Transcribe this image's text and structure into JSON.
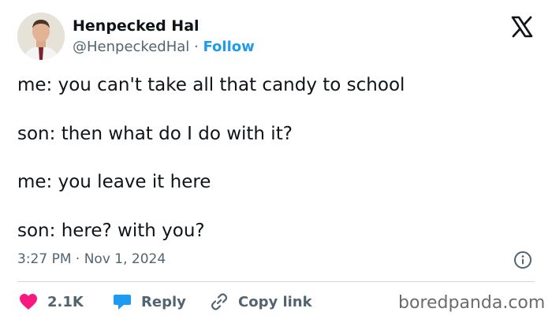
{
  "author": {
    "name": "Henpecked Hal",
    "handle": "@HenpeckedHal",
    "separator": "·",
    "follow_label": "Follow"
  },
  "tweet": {
    "lines": [
      "me: you can't take all that candy to school",
      "son: then what do I do with it?",
      "me: you leave it here",
      "son: here? with you?"
    ],
    "time": "3:27 PM",
    "date_separator": "·",
    "date": "Nov 1, 2024"
  },
  "actions": {
    "likes": "2.1K",
    "reply_label": "Reply",
    "copy_label": "Copy link"
  },
  "watermark": "boredpanda.com",
  "colors": {
    "accent": "#1d9bf0",
    "like": "#f91880",
    "reply": "#1d9bf0",
    "text": "#0f1419",
    "muted": "#536471"
  },
  "icons": {
    "brand": "x-logo-icon",
    "info": "info-icon",
    "like": "heart-icon",
    "reply": "speech-bubble-icon",
    "copy": "link-icon"
  }
}
